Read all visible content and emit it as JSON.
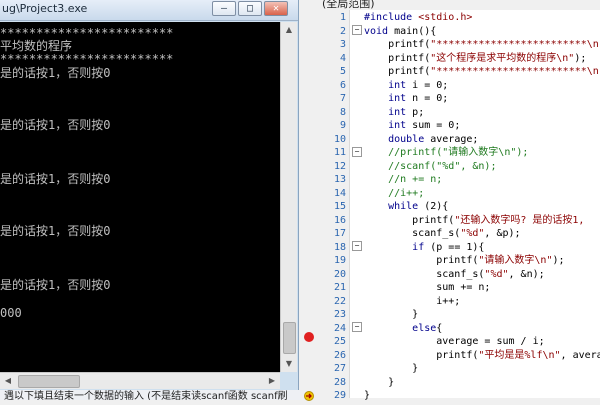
{
  "console": {
    "title": "ug\\Project3.exe",
    "buttons": {
      "minimize": "—",
      "maximize": "□",
      "close": "✕"
    },
    "lines": [
      "************************",
      "平均数的程序",
      "************************",
      "是的话按1，否则按0",
      "",
      "是的话按1，否则按0",
      "",
      "是的话按1，否则按0",
      "",
      "是的话按1，否则按0",
      "",
      "是的话按1，否则按0",
      "000"
    ]
  },
  "editor": {
    "header": "(全局范围)",
    "line_numbers": [
      "1",
      "2",
      "3",
      "4",
      "5",
      "6",
      "7",
      "8",
      "9",
      "10",
      "11",
      "12",
      "13",
      "14",
      "15",
      "16",
      "17",
      "18",
      "19",
      "20",
      "21",
      "22",
      "23",
      "24",
      "25",
      "26",
      "27",
      "28",
      "29"
    ],
    "code": [
      "#include <stdio.h>",
      "void main(){",
      "    printf(\"*************************\\n\");",
      "    printf(\"这个程序是求平均数的程序\\n\");",
      "    printf(\"*************************\\n\");",
      "    int i = 0;",
      "    int n = 0;",
      "    int p;",
      "    int sum = 0;",
      "    double average;",
      "    //printf(\"请输入数字\\n\");",
      "    //scanf(\"%d\", &n);",
      "    //n += n;",
      "    //i++;",
      "    while (2){",
      "        printf(\"还输入数字吗? 是的话按1,",
      "        scanf_s(\"%d\", &p);",
      "        if (p == 1){",
      "            printf(\"请输入数字\\n\");",
      "            scanf_s(\"%d\", &n);",
      "            sum += n;",
      "            i++;",
      "        }",
      "        else{",
      "            average = sum / i;",
      "            printf(\"平均是是%lf\\n\", avera",
      "        }",
      "    }",
      "}"
    ]
  },
  "status": {
    "text": "遇以下填且结束一个数据的输入 (不是结束读scanf函数 scanf刷"
  }
}
